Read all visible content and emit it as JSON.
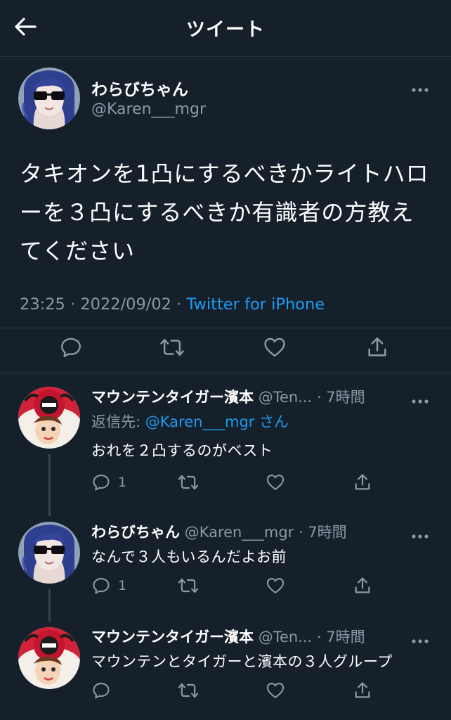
{
  "header": {
    "title": "ツイート"
  },
  "main_tweet": {
    "display_name": "わらびちゃん",
    "handle": "@Karen___mgr",
    "text": "タキオンを1凸にするべきかライトハローを３凸にするべきか有識者の方教えてください",
    "time": "23:25",
    "date": "2022/09/02",
    "source": "Twitter for iPhone",
    "sep": " · "
  },
  "replies": [
    {
      "display_name": "マウンテンタイガー濱本",
      "handle": "@Ten...",
      "time": "7時間",
      "reply_to_label": "返信先: ",
      "reply_to_mention": "@Karen___mgr",
      "reply_to_suffix": " さん",
      "text": "おれを２凸するのがベスト",
      "reply_count": "1"
    },
    {
      "display_name": "わらびちゃん",
      "handle": "@Karen___mgr",
      "time": "7時間",
      "text": "なんで３人もいるんだよお前",
      "reply_count": "1"
    },
    {
      "display_name": "マウンテンタイガー濱本",
      "handle": "@Ten...",
      "time": "7時間",
      "text": "マウンテンとタイガーと濱本の３人グループ",
      "reply_count": ""
    }
  ],
  "icons": [
    "back-arrow-icon",
    "more-icon",
    "reply-icon",
    "retweet-icon",
    "like-icon",
    "share-icon"
  ],
  "colors": {
    "background": "#15202b",
    "link": "#1d9bf0",
    "secondary_text": "#8b98a5",
    "divider": "#2f3b47"
  }
}
